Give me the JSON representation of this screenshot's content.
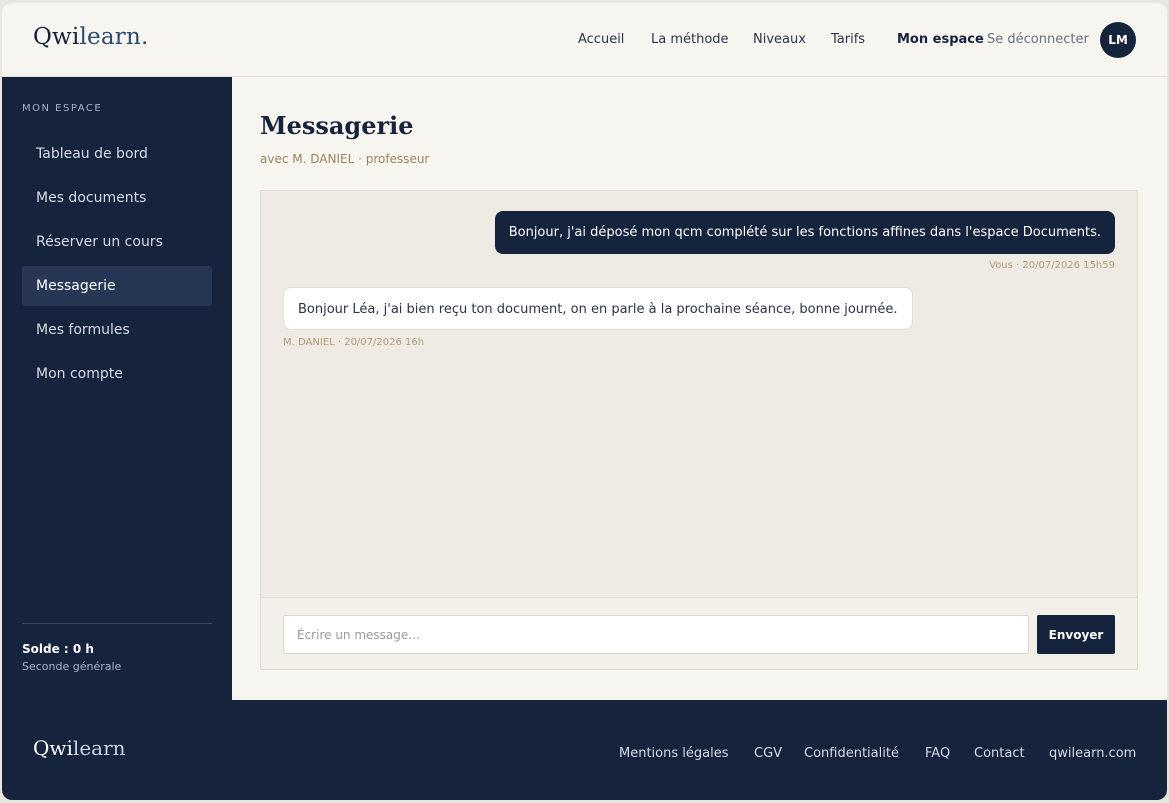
{
  "header": {
    "logo_main": "Qwi",
    "logo_accent": "learn.",
    "nav": [
      "Accueil",
      "La méthode",
      "Niveaux",
      "Tarifs"
    ],
    "my_space": "Mon espace",
    "logout": "Se déconnecter",
    "avatar_initials": "LM"
  },
  "sidebar": {
    "title": "MON ESPACE",
    "items": [
      {
        "label": "Tableau de bord"
      },
      {
        "label": "Mes documents"
      },
      {
        "label": "Réserver un cours"
      },
      {
        "label": "Messagerie",
        "active": true
      },
      {
        "label": "Mes formules"
      },
      {
        "label": "Mon compte"
      }
    ],
    "balance": "Solde : 0 h",
    "level": "Seconde générale"
  },
  "main": {
    "title": "Messagerie",
    "subtitle": "avec M. DANIEL · professeur",
    "messages": [
      {
        "from": "me",
        "text": "Bonjour, j'ai déposé mon qcm complété sur les fonctions affines dans l'espace Documents.",
        "meta": "Vous · 20/07/2026 15h59"
      },
      {
        "from": "them",
        "text": "Bonjour Léa, j'ai bien reçu ton document, on en parle à la prochaine séance, bonne journée.",
        "meta": "M. DANIEL · 20/07/2026 16h"
      }
    ],
    "composer": {
      "placeholder": "Écrire un message…",
      "value": "",
      "send_label": "Envoyer"
    }
  },
  "footer": {
    "logo_main": "Qwi",
    "logo_accent": "learn",
    "links": [
      "Mentions légales",
      "CGV",
      "Confidentialité",
      "FAQ",
      "Contact",
      "qwilearn.com"
    ]
  },
  "colors": {
    "navy": "#16233d",
    "background": "#f6f5f0",
    "chat_background": "#efebe4",
    "accent_meta": "#b09a73"
  }
}
